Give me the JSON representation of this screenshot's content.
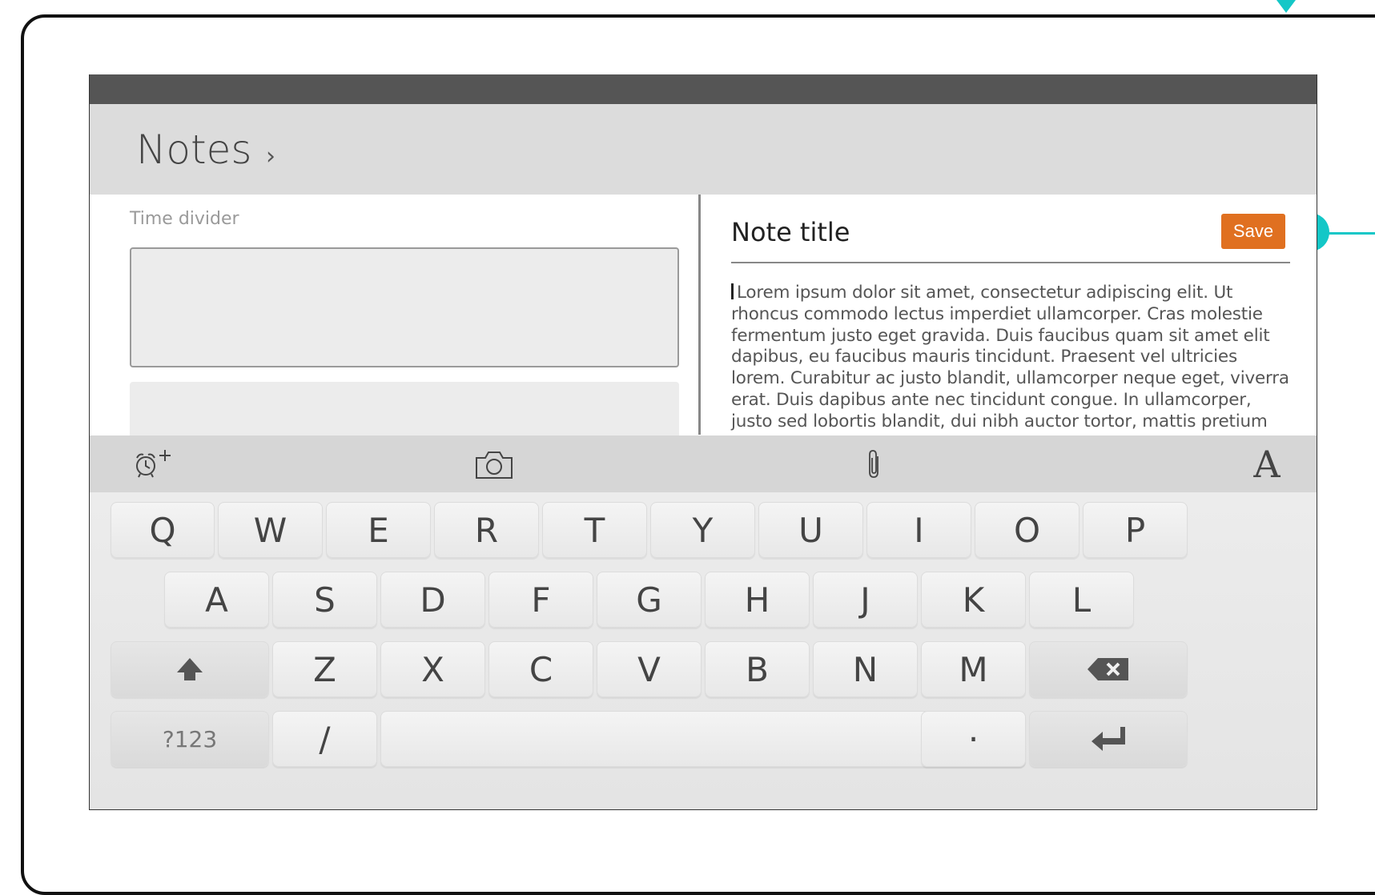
{
  "app": {
    "title": "Notes"
  },
  "left": {
    "divider_label": "Time divider"
  },
  "editor": {
    "title": "Note title",
    "save_label": "Save",
    "body": "Lorem ipsum dolor sit amet, consectetur adipiscing elit. Ut rhoncus commodo lectus imperdiet ullamcorper. Cras molestie fermentum justo eget gravida. Duis faucibus quam sit amet elit dapibus, eu faucibus mauris tincidunt. Praesent vel ultricies lorem. Curabitur ac justo blandit, ullamcorper neque eget, viverra erat. Duis dapibus ante nec tincidunt congue. In ullamcorper, justo sed lobortis blandit, dui nibh auctor tortor, mattis pretium diam tortor"
  },
  "toolbar": {
    "icons": [
      "alarm-add-icon",
      "camera-icon",
      "paperclip-icon",
      "font-icon"
    ],
    "font_glyph": "A",
    "alarm_plus": "+"
  },
  "keyboard": {
    "row1": [
      "Q",
      "W",
      "E",
      "R",
      "T",
      "Y",
      "U",
      "I",
      "O",
      "P"
    ],
    "row2": [
      "A",
      "S",
      "D",
      "F",
      "G",
      "H",
      "J",
      "K",
      "L"
    ],
    "row3": [
      "Z",
      "X",
      "C",
      "V",
      "B",
      "N",
      "M"
    ],
    "numbers_label": "?123",
    "slash_label": "/",
    "period_label": "·"
  },
  "colors": {
    "accent": "#e07020",
    "annotation": "#14c7c7"
  }
}
